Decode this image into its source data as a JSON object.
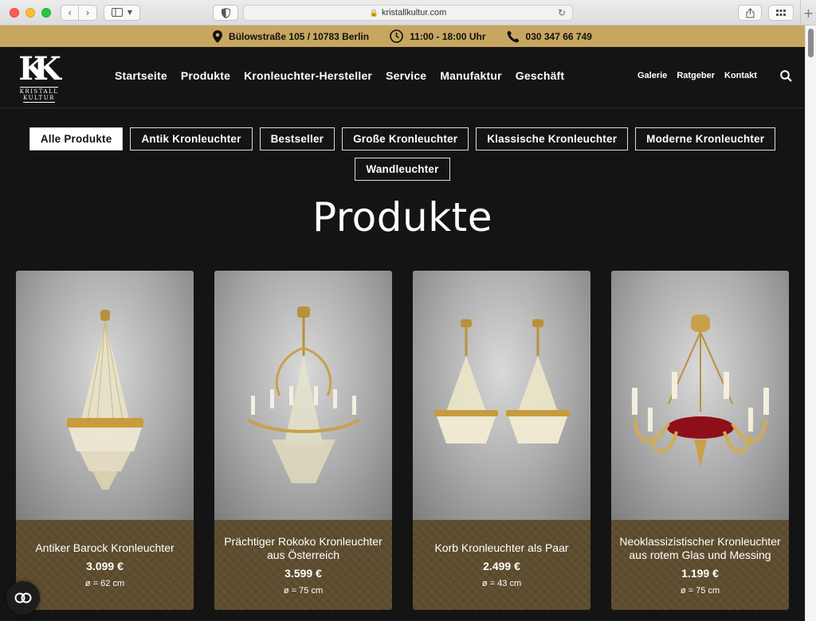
{
  "browser": {
    "url": "kristallkultur.com"
  },
  "infobar": {
    "address": "Bülowstraße 105 / 10783 Berlin",
    "hours": "11:00 - 18:00 Uhr",
    "phone": "030 347 66 749"
  },
  "logo": {
    "mark": "KK",
    "line1": "KRISTALL",
    "line2": "KULTUR"
  },
  "nav": {
    "main": [
      "Startseite",
      "Produkte",
      "Kronleuchter-Hersteller",
      "Service",
      "Manufaktur",
      "Geschäft"
    ],
    "secondary": [
      "Galerie",
      "Ratgeber",
      "Kontakt"
    ]
  },
  "filters": [
    "Alle Produkte",
    "Antik Kronleuchter",
    "Bestseller",
    "Große Kronleuchter",
    "Klassische Kronleuchter",
    "Moderne Kronleuchter",
    "Wandleuchter"
  ],
  "page": {
    "title": "Produkte"
  },
  "products": [
    {
      "name": "Antiker Barock Kronleuchter",
      "price": "3.099 €",
      "dimension": "ø = 62 cm"
    },
    {
      "name": "Prächtiger Rokoko Kronleuchter aus Österreich",
      "price": "3.599 €",
      "dimension": "ø = 75 cm"
    },
    {
      "name": "Korb Kronleuchter als Paar",
      "price": "2.499 €",
      "dimension": "ø = 43 cm"
    },
    {
      "name": "Neoklassizistischer Kronleuchter aus rotem Glas und Messing",
      "price": "1.199 €",
      "dimension": "ø = 75 cm"
    }
  ],
  "colors": {
    "accent_gold": "#c7a660",
    "background": "#141414",
    "card_footer": "#5e4c2f"
  }
}
